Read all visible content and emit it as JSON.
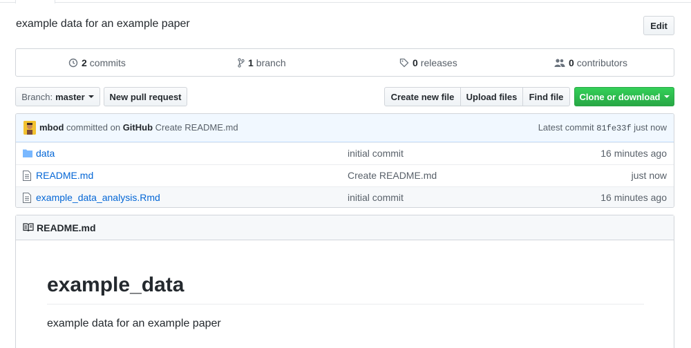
{
  "repo": {
    "description": "example data for an example paper",
    "edit_label": "Edit"
  },
  "summary": {
    "commits_count": "2",
    "commits_label": "commits",
    "branches_count": "1",
    "branches_label": "branch",
    "releases_count": "0",
    "releases_label": "releases",
    "contributors_count": "0",
    "contributors_label": "contributors"
  },
  "toolbar": {
    "branch_prefix": "Branch:",
    "branch_name": "master",
    "new_pr": "New pull request",
    "create_file": "Create new file",
    "upload_files": "Upload files",
    "find_file": "Find file",
    "clone": "Clone or download"
  },
  "commit": {
    "author": "mbod",
    "committed_on": "committed on",
    "platform": "GitHub",
    "message": "Create README.md",
    "latest_label": "Latest commit",
    "sha": "81fe33f",
    "age": "just now"
  },
  "files": [
    {
      "name": "data",
      "type": "folder",
      "message": "initial commit",
      "age": "16 minutes ago"
    },
    {
      "name": "README.md",
      "type": "file",
      "message": "Create README.md",
      "age": "just now"
    },
    {
      "name": "example_data_analysis.Rmd",
      "type": "file",
      "message": "initial commit",
      "age": "16 minutes ago"
    }
  ],
  "readme": {
    "header": "README.md",
    "heading": "example_data",
    "paragraph": "example data for an example paper"
  },
  "colors": {
    "link": "#0366d6",
    "clone_green": "#28a745",
    "commit_bar": "#f1f8ff"
  }
}
